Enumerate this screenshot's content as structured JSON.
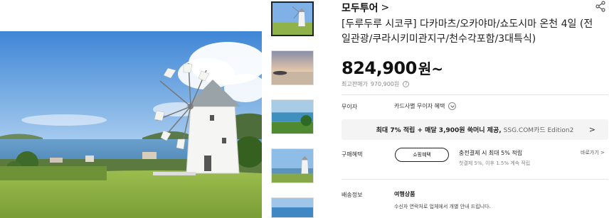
{
  "brand": {
    "name": "모두투어",
    "chevron": ">"
  },
  "product": {
    "title": "[두루두루 시코쿠] 다카마츠/오카야마/쇼도시마 온천 4일 (전일관광/쿠라시키미관지구/천수각포함/3대특식)",
    "price": "824,900",
    "price_unit": "원~",
    "msrp_label": "최고판매가",
    "msrp_value": "970,900원",
    "msrp_info_icon": "?"
  },
  "rows": {
    "interest_label": "무이자",
    "interest_value": "카드사별 무이자 혜택",
    "promo_text_bold": "최대 7% 적립 + 매달 3,900원 쑥머니 제공,",
    "promo_brand": "SSG.COM카드 Edition2",
    "promo_chevron": ">",
    "benefit_label": "구매혜택",
    "shopping_button": "쇼핑혜택",
    "benefit_line1": "충전결제 시 최대 5% 적립",
    "benefit_line2": "첫결제 5%, 이후 1.5% 계속 적립",
    "view_more": "바로가기 >",
    "shipping_label": "배송정보",
    "shipping_type": "여행상품",
    "shipping_note": "수신자 연락처로 업체에서 개별 안내 드립니다."
  },
  "icons": {
    "share": "share-icon",
    "chevron_circle": "chevron-down-circle-icon",
    "info": "info-icon"
  },
  "colors": {
    "text": "#222222",
    "muted": "#888888",
    "promo_bg": "#f4f4f4"
  }
}
